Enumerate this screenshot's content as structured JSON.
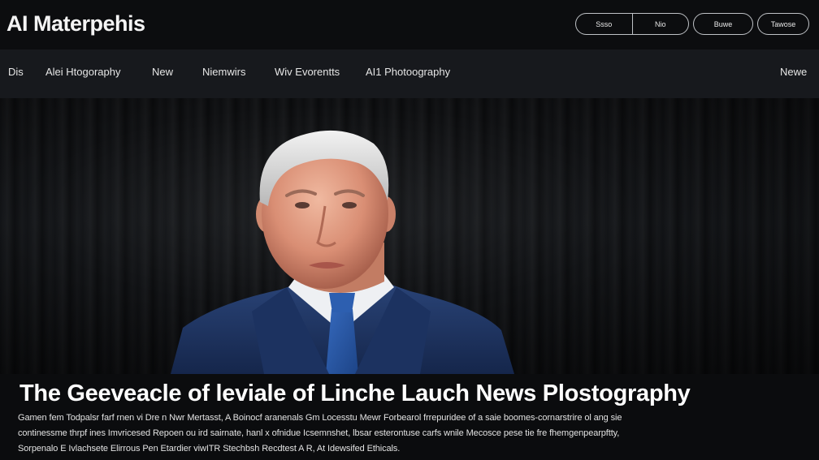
{
  "header": {
    "logo": "AI Materpehis",
    "buttons": [
      "Ssso",
      "Nio",
      "Buwe",
      "Tawose"
    ]
  },
  "nav": {
    "items": [
      "Dis",
      "Alei Htogoraphy",
      "New",
      "Niemwirs",
      "Wiv Evorentts",
      "AI1 Photoography"
    ],
    "right_item": "Newe"
  },
  "article": {
    "headline": "The Geeveacle of leviale of Linche Lauch News Plostography",
    "summary_lines": [
      "Gamen fem Todpalsr farf rnen vi Dre n Nwr Mertasst, A Boinocf aranenals Gm Locesstu Mewr Forbearol frrepuridee of a saie boomes-cornarstrire ol ang sie",
      "continessme thrpf ines Imvricesed Repoen ou ird sairnate, hanl x ofnidue Icsemnshet, lbsar esterontuse carfs wnile Mecosce pese tie fre fhemgenpearpftty,",
      "Sorpenalo E Ivlachsete Elirrous Pen Etardier viwITR Stechbsh Recdtest A R, At Idewsifed Ethicals."
    ]
  },
  "colors": {
    "background": "#0b0c0e",
    "navbar": "#17191d",
    "suit": "#1e3566",
    "tie": "#2a5aa8"
  }
}
